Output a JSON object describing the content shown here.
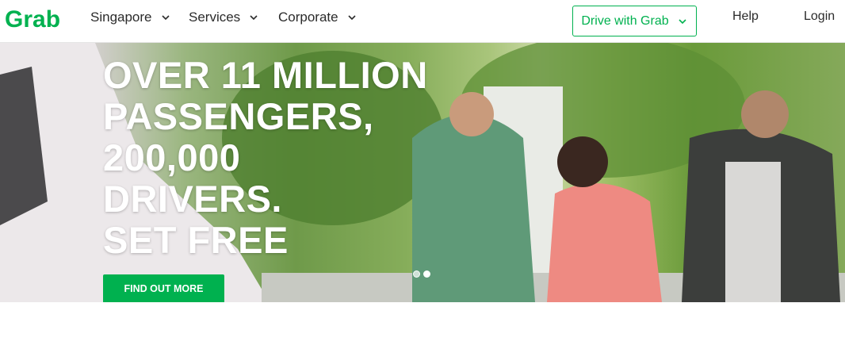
{
  "header": {
    "logo_text": "Grab",
    "nav": [
      {
        "label": "Singapore"
      },
      {
        "label": "Services"
      },
      {
        "label": "Corporate"
      }
    ],
    "drive_button": "Drive with Grab",
    "help": "Help",
    "login": "Login"
  },
  "hero": {
    "title": "OVER 11 MILLION\nPASSENGERS,\n200,000\nDRIVERS.\nSET FREE",
    "cta": "FIND OUT MORE",
    "carousel": {
      "total": 2,
      "active": 2
    }
  },
  "colors": {
    "brand_green": "#00b14f",
    "header_bg": "#ffffff",
    "text": "#2b2b2b"
  }
}
